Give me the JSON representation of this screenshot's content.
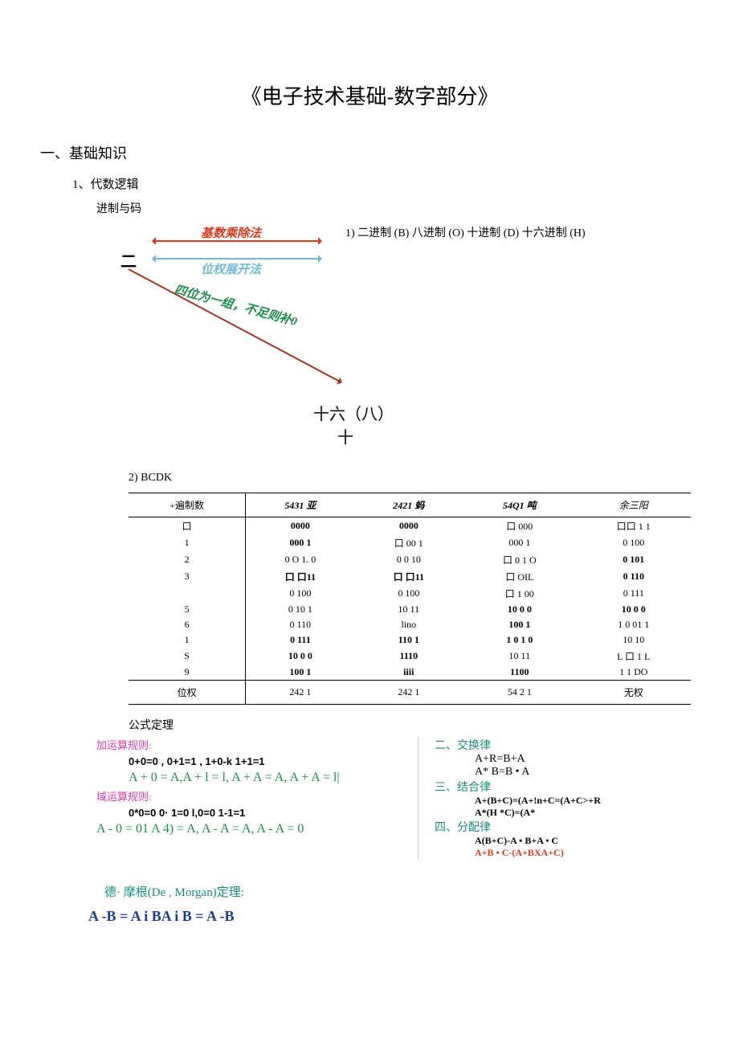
{
  "title": "《电子技术基础-数字部分》",
  "section1": "一、基础知识",
  "sub1_1": "1、代数逻辑",
  "sub1_1a": "进制与码",
  "note1": "1) 二进制 (B) 八进制 (O) 十进制 (D) 十六进制 (H)",
  "diagram": {
    "two": "二",
    "label_orange": "基数乘除法",
    "label_blue": "位权展开法",
    "label_green": "四位为一组，不足则补0",
    "sixteen": "十六（八）",
    "ten": "十"
  },
  "bcd_label": "2) BCDK",
  "table": {
    "headers": [
      "+遍制数",
      "5431 亚",
      "2421 蚂",
      "54Q1 吨",
      "余三阳"
    ],
    "rows": [
      [
        "口",
        "0000",
        "0000",
        "口 000",
        "口口 1 1"
      ],
      [
        "1",
        "000 1",
        "口 00 1",
        "000 1",
        "0 100"
      ],
      [
        "2",
        "0 O 1. 0",
        "0 0 10",
        "口 0 1 O",
        "0 101"
      ],
      [
        "3",
        "口 口11",
        "口 口11",
        "口 OIL",
        "0 110"
      ],
      [
        "",
        "0 100",
        "0 100",
        "口 1 00",
        "0  111"
      ],
      [
        "5",
        "0 10 1",
        "10 11",
        "10 0 0",
        "10 0 0"
      ],
      [
        "6",
        "0 110",
        "lino",
        "100 1",
        "1 0 01 1"
      ],
      [
        "1",
        "0 111",
        "110 1",
        "1 0 1 0",
        "10 10"
      ],
      [
        "S",
        "10 0 0",
        "1110",
        "10 11",
        "L 口 1 L"
      ],
      [
        "9",
        "100 1",
        "iiii",
        "1100",
        "1 1 DO"
      ],
      [
        "位权",
        "242 1",
        "242 1",
        "54 2 1",
        "无权"
      ]
    ]
  },
  "formula_head": "公式定理",
  "left": {
    "add_head": "加运算规则:",
    "add_rule": "0+0=0 , 0+1=1 , 1+0-k 1+1=1",
    "add_formula": "A + 0 = A,A + l = l, A + A = A, A + A = l|",
    "mul_head": "域运算规则:",
    "mul_rule": "0*0=0      0· 1=0    l,0=0      1-1=1",
    "mul_formula": "A - 0 = 01 A 4) = A, A - A = A, A - A = 0"
  },
  "right": {
    "law2_head": "二、交换律",
    "law2_a": "A+R=B+A",
    "law2_b": "A* B=B • A",
    "law3_head": "三、结合律",
    "law3_a": "A+(B+C)=(A+!n+C=(A+C>+R",
    "law3_b": "A*(H *C)=(A*",
    "law4_head": "四、分配律",
    "law4_a": "A(B+C)-A • B+A • C",
    "law4_b": "A+B • C-(A+BXA+C)"
  },
  "demorgan_head": "德· 摩根(De , Morgan)定理:",
  "demorgan_body": "A -B = A i BA i B = A -B"
}
